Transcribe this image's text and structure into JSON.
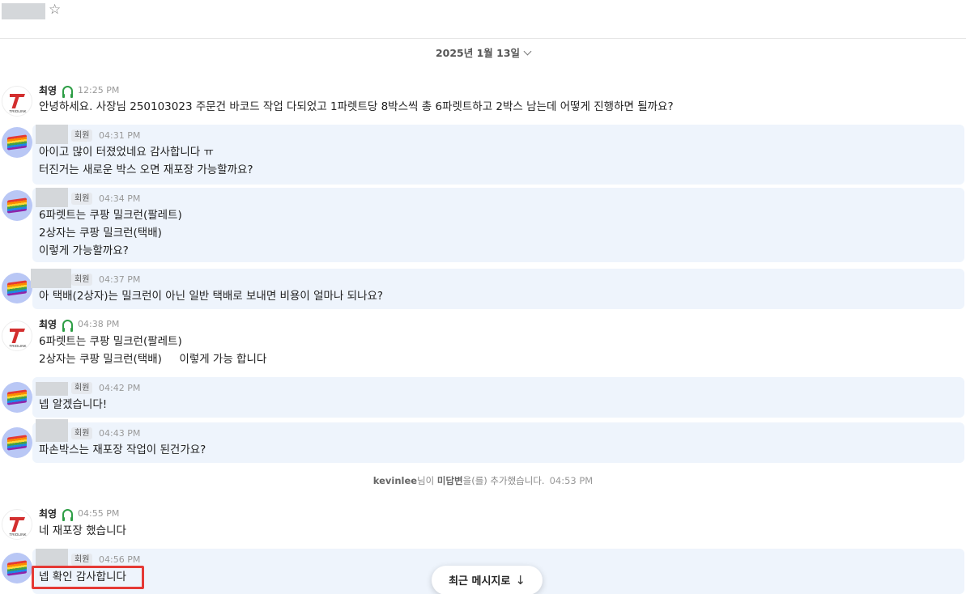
{
  "header": {
    "star_icon": "☆"
  },
  "date_separator": {
    "label": "2025년 1월 13일"
  },
  "messages": [
    {
      "sender": "agent",
      "name": "최영",
      "time": "12:25 PM",
      "lines": [
        "안녕하세요. 사장님 250103023 주문건 바코드 작업 다되었고 1파렛트당 8박스씩 총 6파렛트하고 2박스 남는데 어떻게 진행하면 될까요?"
      ]
    },
    {
      "sender": "user",
      "badge": "회원",
      "time": "04:31 PM",
      "lines": [
        "아이고 많이 터졌었네요 감사합니다 ㅠ",
        "터진거는 새로운 박스 오면 재포장 가능할까요?"
      ]
    },
    {
      "sender": "user",
      "badge": "회원",
      "time": "04:34 PM",
      "lines": [
        "6파렛트는 쿠팡 밀크런(팔레트)",
        "2상자는 쿠팡 밀크런(택배)",
        "이렇게 가능할까요?"
      ]
    },
    {
      "sender": "user",
      "badge": "회원",
      "time": "04:37 PM",
      "lines": [
        "아 택배(2상자)는 밀크런이 아닌 일반 택배로 보내면 비용이 얼마나 되나요?"
      ]
    },
    {
      "sender": "agent",
      "name": "최영",
      "time": "04:38 PM",
      "lines": [
        "6파렛트는 쿠팡 밀크런(팔레트)",
        "2상자는 쿠팡 밀크런(택배)     이렇게 가능 합니다"
      ]
    },
    {
      "sender": "user",
      "badge": "회원",
      "time": "04:42 PM",
      "lines": [
        "넵 알겠습니다!"
      ]
    },
    {
      "sender": "user",
      "badge": "회원",
      "time": "04:43 PM",
      "lines": [
        "파손박스는 재포장 작업이 된건가요?"
      ]
    },
    {
      "sender": "agent",
      "name": "최영",
      "time": "04:55 PM",
      "lines": [
        "네 재포장 했습니다"
      ]
    },
    {
      "sender": "user",
      "badge": "회원",
      "time": "04:56 PM",
      "lines": [
        "넵 확인 감사합니다"
      ]
    }
  ],
  "system_message": {
    "user": "kevinlee",
    "mid1": "님이 ",
    "tag": "미답변",
    "mid2": "을(를) 추가했습니다.",
    "time": "04:53 PM"
  },
  "agent_logo_text": "TRIOLINK",
  "jump_button": {
    "label": "최근 메시지로",
    "icon": "arrow-down-icon",
    "arrow": "↓"
  },
  "colors": {
    "user_bubble": "#eef4fc",
    "highlight": "#e53935",
    "online": "#2e9e46"
  }
}
